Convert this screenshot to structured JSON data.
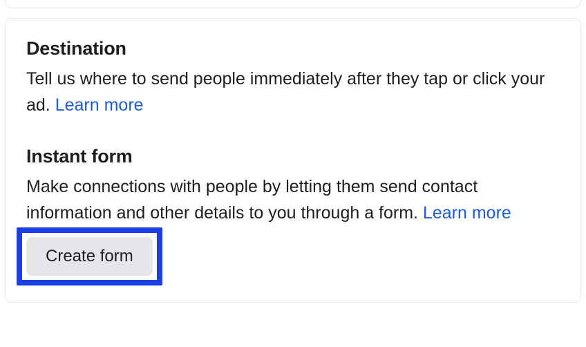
{
  "destination": {
    "heading": "Destination",
    "description": "Tell us where to send people immediately after they tap or click your ad. ",
    "learn_more": "Learn more"
  },
  "instant_form": {
    "heading": "Instant form",
    "description": "Make connections with people by letting them send contact information and other details to you through a form. ",
    "learn_more": "Learn more",
    "button_label": "Create form"
  }
}
